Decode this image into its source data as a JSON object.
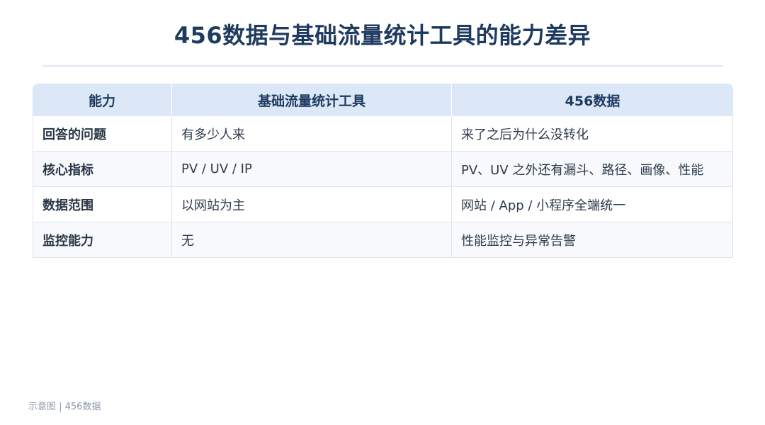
{
  "title": "456数据与基础流量统计工具的能力差异",
  "table": {
    "headers": [
      "能力",
      "基础流量统计工具",
      "456数据"
    ],
    "rows": [
      [
        "回答的问题",
        "有多少人来",
        "来了之后为什么没转化"
      ],
      [
        "核心指标",
        "PV / UV / IP",
        "PV、UV 之外还有漏斗、路径、画像、性能"
      ],
      [
        "数据范围",
        "以网站为主",
        "网站 / App / 小程序全端统一"
      ],
      [
        "监控能力",
        "无",
        "性能监控与异常告警"
      ]
    ]
  },
  "footer": "示意图 | 456数据",
  "colors": {
    "title": "#1f3a5f",
    "header_bg": "#dce8f7",
    "row_alt_bg": "#f7f9fc",
    "border": "#dfe4ea",
    "footer_text": "#8a97a8"
  }
}
